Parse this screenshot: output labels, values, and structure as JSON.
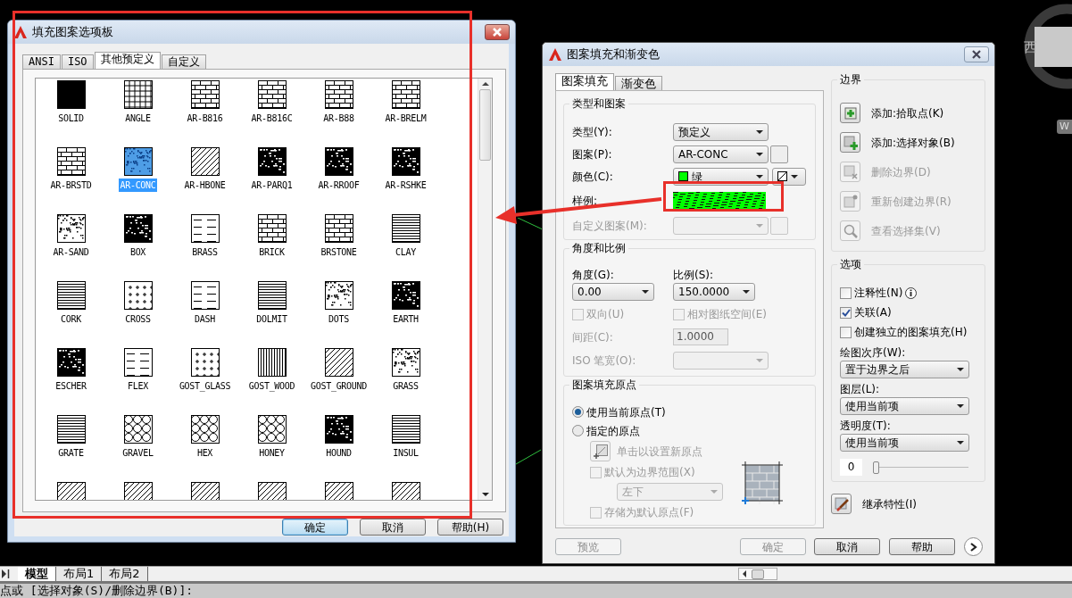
{
  "palette_dialog": {
    "title": "填充图案选项板",
    "tabs": [
      {
        "label": "ANSI",
        "selected": false
      },
      {
        "label": "ISO",
        "selected": false
      },
      {
        "label": "其他预定义",
        "selected": true
      },
      {
        "label": "自定义",
        "selected": false
      }
    ],
    "patterns": [
      {
        "label": "SOLID",
        "selected": false
      },
      {
        "label": "ANGLE",
        "selected": false
      },
      {
        "label": "AR-B816",
        "selected": false
      },
      {
        "label": "AR-B816C",
        "selected": false
      },
      {
        "label": "AR-B88",
        "selected": false
      },
      {
        "label": "AR-BRELM",
        "selected": false
      },
      {
        "label": "AR-BRSTD",
        "selected": false
      },
      {
        "label": "AR-CONC",
        "selected": true
      },
      {
        "label": "AR-HBONE",
        "selected": false
      },
      {
        "label": "AR-PARQ1",
        "selected": false
      },
      {
        "label": "AR-RROOF",
        "selected": false
      },
      {
        "label": "AR-RSHKE",
        "selected": false
      },
      {
        "label": "AR-SAND",
        "selected": false
      },
      {
        "label": "BOX",
        "selected": false
      },
      {
        "label": "BRASS",
        "selected": false
      },
      {
        "label": "BRICK",
        "selected": false
      },
      {
        "label": "BRSTONE",
        "selected": false
      },
      {
        "label": "CLAY",
        "selected": false
      },
      {
        "label": "CORK",
        "selected": false
      },
      {
        "label": "CROSS",
        "selected": false
      },
      {
        "label": "DASH",
        "selected": false
      },
      {
        "label": "DOLMIT",
        "selected": false
      },
      {
        "label": "DOTS",
        "selected": false
      },
      {
        "label": "EARTH",
        "selected": false
      },
      {
        "label": "ESCHER",
        "selected": false
      },
      {
        "label": "FLEX",
        "selected": false
      },
      {
        "label": "GOST_GLASS",
        "selected": false
      },
      {
        "label": "GOST_WOOD",
        "selected": false
      },
      {
        "label": "GOST_GROUND",
        "selected": false
      },
      {
        "label": "GRASS",
        "selected": false
      },
      {
        "label": "GRATE",
        "selected": false
      },
      {
        "label": "GRAVEL",
        "selected": false
      },
      {
        "label": "HEX",
        "selected": false
      },
      {
        "label": "HONEY",
        "selected": false
      },
      {
        "label": "HOUND",
        "selected": false
      },
      {
        "label": "INSUL",
        "selected": false
      },
      {
        "selected": false
      },
      {
        "selected": false
      },
      {
        "selected": false
      },
      {
        "selected": false
      },
      {
        "selected": false
      },
      {
        "selected": false
      }
    ],
    "buttons": [
      {
        "label": "确定",
        "focused": true
      },
      {
        "label": "取消",
        "focused": false
      },
      {
        "label": "帮助(H)",
        "focused": false
      }
    ]
  },
  "hatch_dialog": {
    "title": "图案填充和渐变色",
    "tabs": [
      {
        "label": "图案填充",
        "selected": true
      },
      {
        "label": "渐变色",
        "selected": false
      }
    ],
    "type_and_pattern": {
      "title": "类型和图案",
      "type": {
        "label": "类型(Y):",
        "value": "预定义"
      },
      "pattern": {
        "label": "图案(P):",
        "value": "AR-CONC"
      },
      "color": {
        "label": "颜色(C):",
        "value": "绿",
        "color": "#00ff00"
      },
      "sample": {
        "label": "样例:"
      },
      "custom_pattern": {
        "label": "自定义图案(M):",
        "disabled": true
      }
    },
    "angle_and_scale": {
      "title": "角度和比例",
      "angle": {
        "label": "角度(G):",
        "value": "0.00"
      },
      "scale": {
        "label": "比例(S):",
        "value": "150.0000"
      },
      "double": {
        "label": "双向(U)",
        "checked": false,
        "disabled": true
      },
      "relative": {
        "label": "相对图纸空间(E)",
        "checked": false,
        "disabled": true
      },
      "spacing": {
        "label": "间距(C):",
        "value": "1.0000",
        "disabled": true
      },
      "iso_pen": {
        "label": "ISO 笔宽(O):",
        "disabled": true
      }
    },
    "origin": {
      "title": "图案填充原点",
      "radios": [
        {
          "label": "使用当前原点(T)",
          "selected": true
        },
        {
          "label": "指定的原点",
          "selected": false
        }
      ],
      "set_origin": {
        "label": "单击以设置新原点",
        "disabled": true
      },
      "default_extents": {
        "label": "默认为边界范围(X)",
        "checked": false,
        "disabled": true
      },
      "position": {
        "value": "左下",
        "disabled": true
      },
      "store": {
        "label": "存储为默认原点(F)",
        "checked": false,
        "disabled": true
      }
    },
    "boundaries": {
      "title": "边界",
      "items": [
        {
          "label": "添加:拾取点(K)",
          "disabled": false
        },
        {
          "label": "添加:选择对象(B)",
          "disabled": false
        },
        {
          "label": "删除边界(D)",
          "disabled": true
        },
        {
          "label": "重新创建边界(R)",
          "disabled": true
        },
        {
          "label": "查看选择集(V)",
          "disabled": true
        }
      ]
    },
    "options": {
      "title": "选项",
      "checks": [
        {
          "label": "注释性(N)",
          "checked": false
        },
        {
          "label": "关联(A)",
          "checked": true
        },
        {
          "label": "创建独立的图案填充(H)",
          "checked": false
        }
      ],
      "draw_order": {
        "label": "绘图次序(W):",
        "value": "置于边界之后"
      },
      "layer": {
        "label": "图层(L):",
        "value": "使用当前项"
      },
      "transparency": {
        "label": "透明度(T):",
        "value": "使用当前项",
        "amount": "0",
        "level": 0
      }
    },
    "inherit": {
      "label": "继承特性(I)"
    },
    "buttons": [
      {
        "label": "预览",
        "disabled": true
      },
      {
        "label": "确定",
        "disabled": true
      },
      {
        "label": "取消",
        "disabled": false
      },
      {
        "label": "帮助",
        "disabled": false
      }
    ]
  },
  "layout_tabs": [
    {
      "label": "模型",
      "selected": true
    },
    {
      "label": "布局1",
      "selected": false
    },
    {
      "label": "布局2",
      "selected": false
    }
  ],
  "command_line": "点或 [选择对象(S)/删除边界(B)]:",
  "view_cube": {
    "direction": "西",
    "badge": "W"
  }
}
